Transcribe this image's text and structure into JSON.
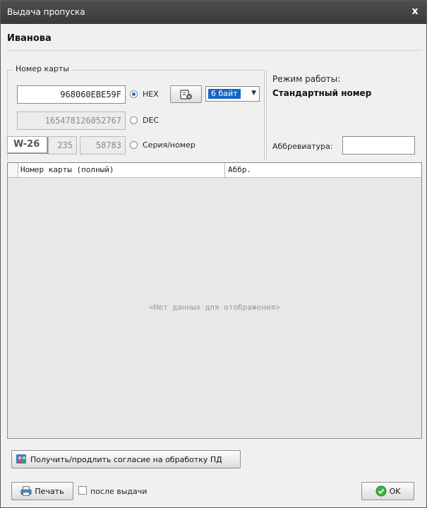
{
  "window": {
    "title": "Выдача пропуска",
    "close_glyph": "x"
  },
  "person_name": "Иванова",
  "card_group": {
    "label": "Номер карты",
    "hex_value": "968060EBE59F",
    "hex_label": "HEX",
    "dec_value": "165478126052767",
    "dec_label": "DEC",
    "series_prefix": "W-26",
    "series_value": "235",
    "number_value": "58783",
    "series_label": "Серия/номер",
    "selected_mode": "HEX",
    "byte_select": "6 байт"
  },
  "mode": {
    "label": "Режим работы:",
    "value": "Стандартный номер"
  },
  "abbreviation": {
    "label": "Аббревиатура:",
    "value": ""
  },
  "grid": {
    "columns": [
      "Номер карты (полный)",
      "Аббр."
    ],
    "empty_text": "<Нет данных для отображения>"
  },
  "consent_button": {
    "label": "Получить/продлить согласие на обработку ПД",
    "icon": "consent-icon"
  },
  "print_button": {
    "label": "Печать",
    "icon": "printer-icon"
  },
  "after_issue": {
    "label": "после выдачи",
    "checked": false
  },
  "ok_button": {
    "label": "OK",
    "icon": "check-circle-icon"
  }
}
